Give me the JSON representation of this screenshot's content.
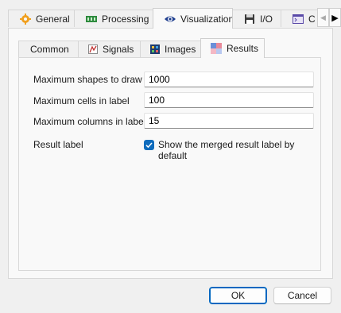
{
  "main_tabs": [
    {
      "label": "General",
      "icon": "gear-icon"
    },
    {
      "label": "Processing",
      "icon": "processing-icon"
    },
    {
      "label": "Visualization",
      "icon": "eye-icon"
    },
    {
      "label": "I/O",
      "icon": "floppy-disk-icon"
    },
    {
      "label": "C",
      "icon": "console-icon"
    }
  ],
  "main_active_tab": "Visualization",
  "scroll_arrows": {
    "left": "◀",
    "right": "▶"
  },
  "sub_tabs": [
    {
      "label": "Common",
      "icon": ""
    },
    {
      "label": "Signals",
      "icon": "signal-icon"
    },
    {
      "label": "Images",
      "icon": "image-icon"
    },
    {
      "label": "Results",
      "icon": "results-icon"
    }
  ],
  "sub_active_tab": "Results",
  "form": {
    "max_shapes": {
      "label": "Maximum shapes to draw",
      "value": "1000"
    },
    "max_cells": {
      "label": "Maximum cells in label",
      "value": "100"
    },
    "max_columns": {
      "label": "Maximum columns in label",
      "value": "15"
    },
    "result_label": {
      "label": "Result label",
      "checkbox_label": "Show the merged result label by default",
      "checked": true
    }
  },
  "buttons": {
    "ok": "OK",
    "cancel": "Cancel"
  },
  "colors": {
    "accent": "#0f6cbd",
    "ok_border": "#0067c0"
  }
}
